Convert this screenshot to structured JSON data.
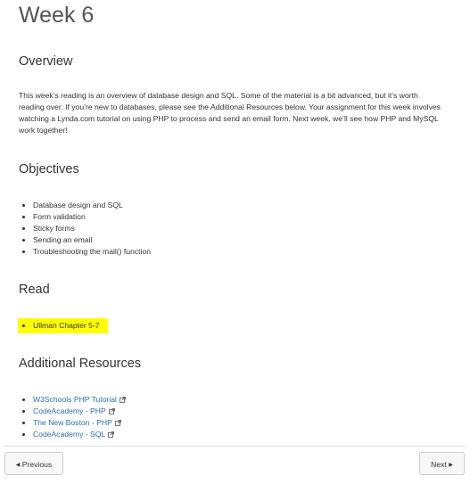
{
  "page": {
    "title": "Week 6"
  },
  "overview": {
    "heading": "Overview",
    "text": "This week’s reading is an overview of database design and SQL. Some of the material is a bit advanced, but it’s worth reading over. If you’re new to databases, please see the Additional Resources below. Your assignment for this week involves watching a Lynda.com tutorial on using PHP to process and send an email form. Next week, we’ll see how PHP and MySQL work together!"
  },
  "objectives": {
    "heading": "Objectives",
    "items": [
      "Database design and SQL",
      "Form validation",
      "Sticky forms",
      "Sending an email",
      "Troubleshooting the mail() function"
    ]
  },
  "read": {
    "heading": "Read",
    "items": [
      "Ullman Chapter 5-7"
    ],
    "highlight_color": "#ffff00"
  },
  "resources": {
    "heading": "Additional Resources",
    "items": [
      "W3Schools PHP Tutorial",
      "CodeAcademy - PHP",
      "The New Boston - PHP",
      "CodeAcademy - SQL"
    ],
    "link_color": "#2a6fb0",
    "icon": "external-link-icon"
  },
  "nav": {
    "prev_label": "Previous",
    "next_label": "Next",
    "prev_icon": "caret-left-icon",
    "next_icon": "caret-right-icon"
  }
}
